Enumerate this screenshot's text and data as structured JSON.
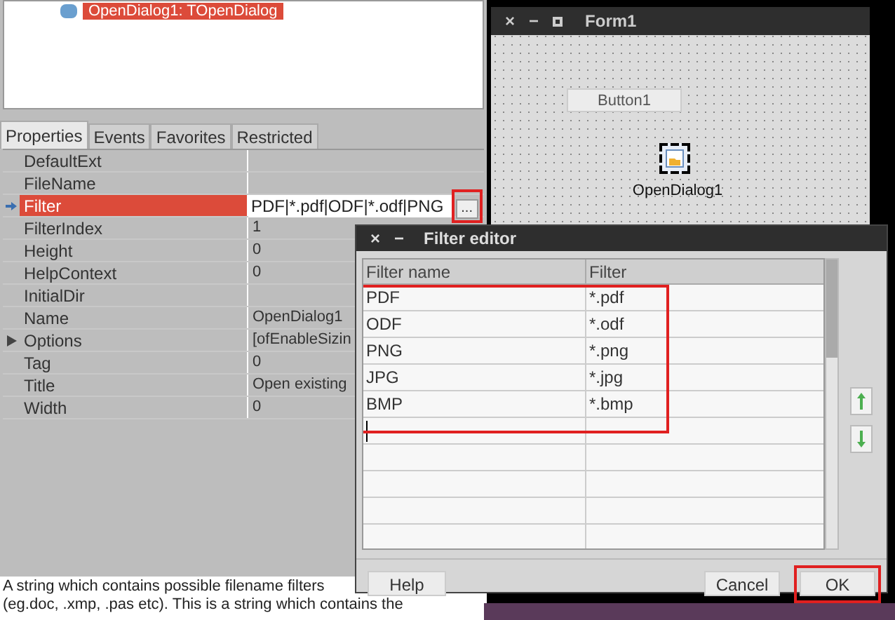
{
  "tree": {
    "items": [
      {
        "label": "OpenDialog1: TOpenDialog",
        "selected": true
      }
    ]
  },
  "inspector": {
    "tabs": [
      {
        "label": "Properties",
        "selected": true
      },
      {
        "label": "Events",
        "selected": false
      },
      {
        "label": "Favorites",
        "selected": false
      },
      {
        "label": "Restricted",
        "selected": false
      }
    ],
    "properties": [
      {
        "name": "DefaultExt",
        "selected": false,
        "expandable": false
      },
      {
        "name": "FileName",
        "selected": false,
        "expandable": false
      },
      {
        "name": "Filter",
        "value": "PDF|*.pdf|ODF|*.odf|PNG",
        "selected": true,
        "expandable": false,
        "ellipsis": "...",
        "highlighted": true
      },
      {
        "name": "FilterIndex",
        "value": "1",
        "selected": false,
        "expandable": false
      },
      {
        "name": "Height",
        "value": "0",
        "selected": false,
        "expandable": false
      },
      {
        "name": "HelpContext",
        "value": "0",
        "selected": false,
        "expandable": false
      },
      {
        "name": "InitialDir",
        "selected": false,
        "expandable": false
      },
      {
        "name": "Name",
        "value": "OpenDialog1",
        "selected": false,
        "expandable": false
      },
      {
        "name": "Options",
        "value": "[ofEnableSizin",
        "selected": false,
        "expandable": true
      },
      {
        "name": "Tag",
        "value": "0",
        "selected": false,
        "expandable": false
      },
      {
        "name": "Title",
        "value": "Open existing",
        "selected": false,
        "expandable": false
      },
      {
        "name": "Width",
        "value": "0",
        "selected": false,
        "expandable": false
      }
    ],
    "description": [
      "A string which contains possible filename filters",
      "(eg.doc, .xmp, .pas etc). This is a string which contains the"
    ]
  },
  "form": {
    "title": "Form1",
    "close": "×",
    "minimize": "−",
    "button": "Button1",
    "component": "OpenDialog1"
  },
  "filter_editor": {
    "title": "Filter editor",
    "close": "×",
    "minimize": "−",
    "columns": [
      "Filter name",
      "Filter"
    ],
    "highlighted": true,
    "rows": [
      {
        "name": "PDF",
        "filter": "*.pdf"
      },
      {
        "name": "ODF",
        "filter": "*.odf"
      },
      {
        "name": "PNG",
        "filter": "*.png"
      },
      {
        "name": "JPG",
        "filter": "*.jpg"
      },
      {
        "name": "BMP",
        "filter": "*.bmp"
      }
    ],
    "buttons": [
      {
        "label": "Help",
        "highlighted": false
      },
      {
        "label": "Cancel",
        "highlighted": false
      },
      {
        "label": "OK",
        "highlighted": true
      }
    ]
  }
}
